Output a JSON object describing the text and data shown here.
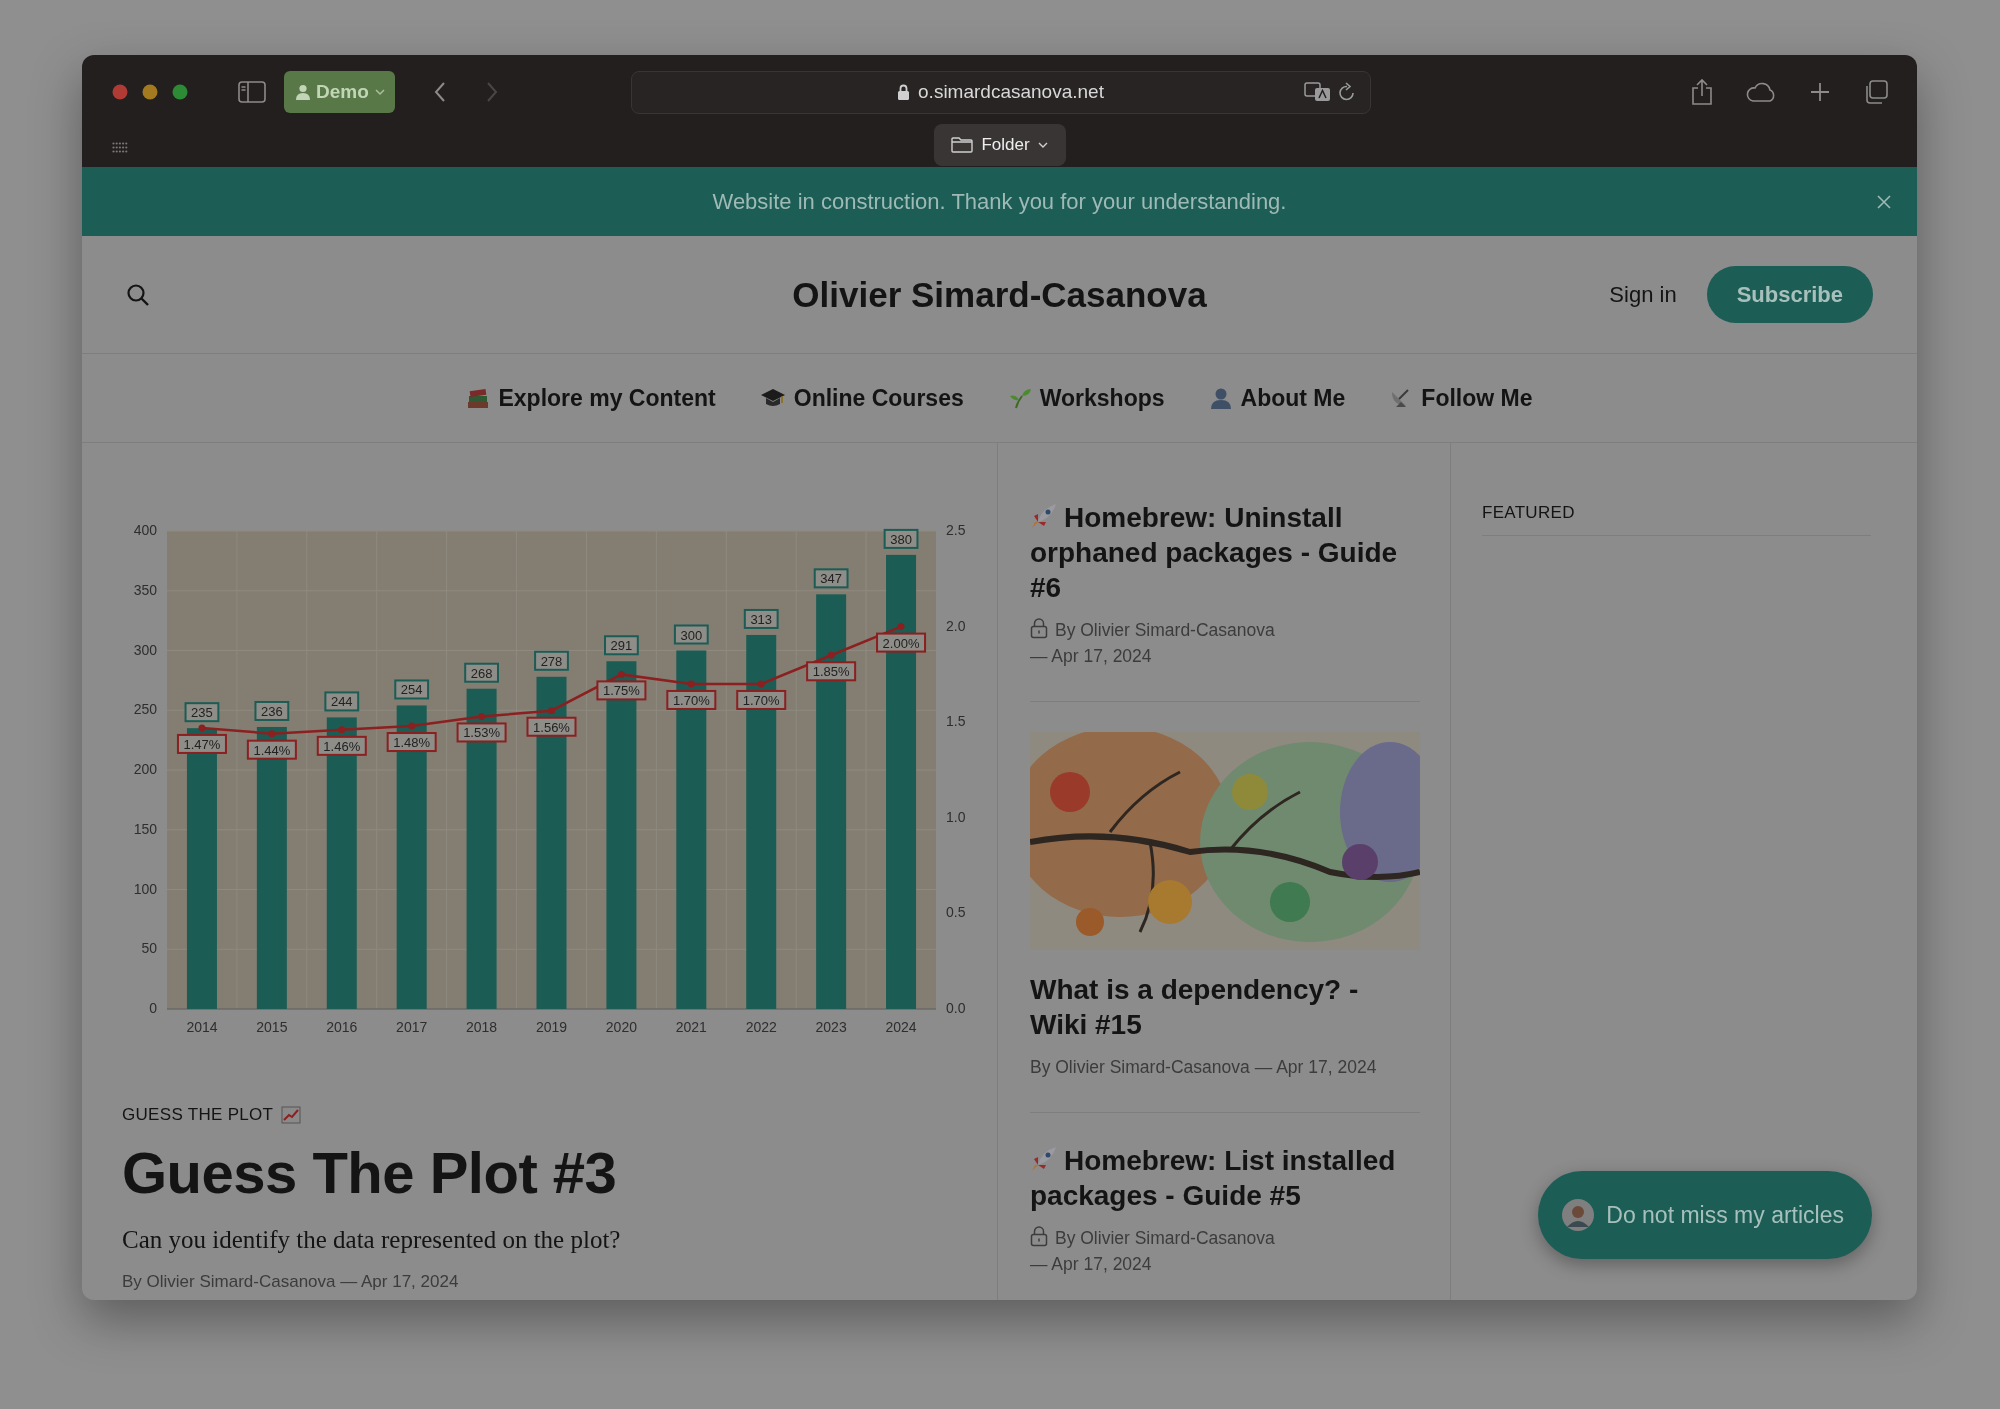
{
  "browser": {
    "profile": "Demo",
    "url": "o.simardcasanova.net",
    "tab_group": "Folder",
    "nav_buttons": [
      {
        "kind": "back",
        "disabled": false
      },
      {
        "kind": "forward",
        "disabled": true
      }
    ]
  },
  "banner": {
    "text": "Website in construction. Thank you for your understanding."
  },
  "header": {
    "site_title": "Olivier Simard-Casanova",
    "sign_in": "Sign in",
    "subscribe": "Subscribe"
  },
  "nav": [
    {
      "kind": "books",
      "label": "Explore my Content"
    },
    {
      "kind": "cap",
      "label": "Online Courses"
    },
    {
      "kind": "sprout",
      "label": "Workshops"
    },
    {
      "kind": "person",
      "label": "About Me"
    },
    {
      "kind": "dish",
      "label": "Follow Me"
    }
  ],
  "article": {
    "chart_data": {
      "type": "bar",
      "categories": [
        "2014",
        "2015",
        "2016",
        "2017",
        "2018",
        "2019",
        "2020",
        "2021",
        "2022",
        "2023",
        "2024"
      ],
      "ylim": [
        0,
        400
      ],
      "yticks": [
        0,
        50,
        100,
        150,
        200,
        250,
        300,
        350,
        400
      ],
      "grid": true,
      "series": [
        {
          "color": "#1b5d55",
          "values": [
            235,
            236,
            244,
            254,
            268,
            278,
            291,
            300,
            313,
            347,
            380
          ],
          "value_labels": [
            "235",
            "236",
            "244",
            "254",
            "268",
            "278",
            "291",
            "300",
            "313",
            "347",
            "380"
          ]
        }
      ]
    },
    "overlay": {
      "chart_data": {
        "type": "line",
        "ylim": [
          0,
          2.5
        ],
        "yticks": [
          {
            "value": 0,
            "label": "0.0"
          },
          {
            "value": 0.5,
            "label": "0.5"
          },
          {
            "value": 1,
            "label": "1.0"
          },
          {
            "value": 1.5,
            "label": "1.5"
          },
          {
            "value": 2,
            "label": "2.0"
          },
          {
            "value": 2.5,
            "label": "2.5"
          }
        ],
        "series": [
          {
            "color": "#8c1f1f",
            "marker": "circle",
            "values": [
              1.47,
              1.44,
              1.46,
              1.48,
              1.53,
              1.56,
              1.75,
              1.7,
              1.7,
              1.85,
              2.0
            ],
            "value_labels": [
              "1.47%",
              "1.44%",
              "1.46%",
              "1.48%",
              "1.53%",
              "1.56%",
              "1.75%",
              "1.70%",
              "1.70%",
              "1.85%",
              "2.00%"
            ]
          }
        ]
      }
    },
    "tag": "GUESS THE PLOT",
    "title": "Guess The Plot #3",
    "excerpt": "Can you identify the data represented on the plot?",
    "byline": "By Olivier Simard-Casanova — Apr 17, 2024"
  },
  "posts": [
    {
      "kind": "guide",
      "title": "Homebrew: Uninstall orphaned packages - Guide #6",
      "locked": true,
      "byline": "By Olivier Simard-Casanova",
      "date": "— Apr 17, 2024"
    },
    {
      "kind": "wiki",
      "title": "What is a dependency? - Wiki #15",
      "locked": false,
      "byline": "By Olivier Simard-Casanova",
      "date": "— Apr 17, 2024"
    },
    {
      "kind": "guide",
      "title": "Homebrew: List installed packages - Guide #5",
      "locked": true,
      "byline": "By Olivier Simard-Casanova",
      "date": "— Apr 17, 2024"
    }
  ],
  "sidebar": {
    "heading": "FEATURED"
  },
  "cta": {
    "label": "Do not miss my articles"
  }
}
